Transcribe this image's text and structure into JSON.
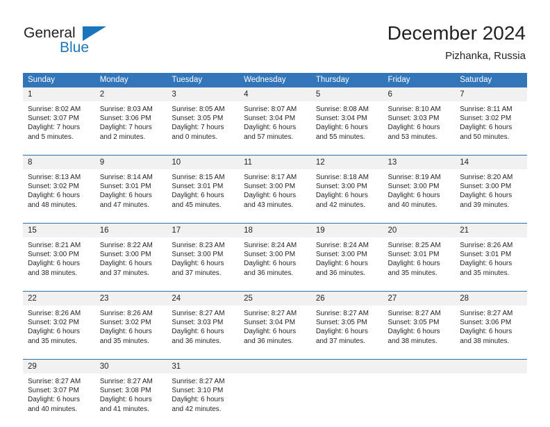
{
  "brand": {
    "name_part1": "General",
    "name_part2": "Blue"
  },
  "header": {
    "title": "December 2024",
    "subtitle": "Pizhanka, Russia"
  },
  "colors": {
    "header_blue": "#3275b9",
    "separator_blue": "#2f6fa8",
    "daynum_strip": "#f1f1f1",
    "brand_blue": "#1b75bb",
    "text": "#231f20"
  },
  "weekdays": [
    "Sunday",
    "Monday",
    "Tuesday",
    "Wednesday",
    "Thursday",
    "Friday",
    "Saturday"
  ],
  "weeks": [
    {
      "days": [
        {
          "num": "1",
          "sunrise": "Sunrise: 8:02 AM",
          "sunset": "Sunset: 3:07 PM",
          "daylight1": "Daylight: 7 hours",
          "daylight2": "and 5 minutes."
        },
        {
          "num": "2",
          "sunrise": "Sunrise: 8:03 AM",
          "sunset": "Sunset: 3:06 PM",
          "daylight1": "Daylight: 7 hours",
          "daylight2": "and 2 minutes."
        },
        {
          "num": "3",
          "sunrise": "Sunrise: 8:05 AM",
          "sunset": "Sunset: 3:05 PM",
          "daylight1": "Daylight: 7 hours",
          "daylight2": "and 0 minutes."
        },
        {
          "num": "4",
          "sunrise": "Sunrise: 8:07 AM",
          "sunset": "Sunset: 3:04 PM",
          "daylight1": "Daylight: 6 hours",
          "daylight2": "and 57 minutes."
        },
        {
          "num": "5",
          "sunrise": "Sunrise: 8:08 AM",
          "sunset": "Sunset: 3:04 PM",
          "daylight1": "Daylight: 6 hours",
          "daylight2": "and 55 minutes."
        },
        {
          "num": "6",
          "sunrise": "Sunrise: 8:10 AM",
          "sunset": "Sunset: 3:03 PM",
          "daylight1": "Daylight: 6 hours",
          "daylight2": "and 53 minutes."
        },
        {
          "num": "7",
          "sunrise": "Sunrise: 8:11 AM",
          "sunset": "Sunset: 3:02 PM",
          "daylight1": "Daylight: 6 hours",
          "daylight2": "and 50 minutes."
        }
      ]
    },
    {
      "days": [
        {
          "num": "8",
          "sunrise": "Sunrise: 8:13 AM",
          "sunset": "Sunset: 3:02 PM",
          "daylight1": "Daylight: 6 hours",
          "daylight2": "and 48 minutes."
        },
        {
          "num": "9",
          "sunrise": "Sunrise: 8:14 AM",
          "sunset": "Sunset: 3:01 PM",
          "daylight1": "Daylight: 6 hours",
          "daylight2": "and 47 minutes."
        },
        {
          "num": "10",
          "sunrise": "Sunrise: 8:15 AM",
          "sunset": "Sunset: 3:01 PM",
          "daylight1": "Daylight: 6 hours",
          "daylight2": "and 45 minutes."
        },
        {
          "num": "11",
          "sunrise": "Sunrise: 8:17 AM",
          "sunset": "Sunset: 3:00 PM",
          "daylight1": "Daylight: 6 hours",
          "daylight2": "and 43 minutes."
        },
        {
          "num": "12",
          "sunrise": "Sunrise: 8:18 AM",
          "sunset": "Sunset: 3:00 PM",
          "daylight1": "Daylight: 6 hours",
          "daylight2": "and 42 minutes."
        },
        {
          "num": "13",
          "sunrise": "Sunrise: 8:19 AM",
          "sunset": "Sunset: 3:00 PM",
          "daylight1": "Daylight: 6 hours",
          "daylight2": "and 40 minutes."
        },
        {
          "num": "14",
          "sunrise": "Sunrise: 8:20 AM",
          "sunset": "Sunset: 3:00 PM",
          "daylight1": "Daylight: 6 hours",
          "daylight2": "and 39 minutes."
        }
      ]
    },
    {
      "days": [
        {
          "num": "15",
          "sunrise": "Sunrise: 8:21 AM",
          "sunset": "Sunset: 3:00 PM",
          "daylight1": "Daylight: 6 hours",
          "daylight2": "and 38 minutes."
        },
        {
          "num": "16",
          "sunrise": "Sunrise: 8:22 AM",
          "sunset": "Sunset: 3:00 PM",
          "daylight1": "Daylight: 6 hours",
          "daylight2": "and 37 minutes."
        },
        {
          "num": "17",
          "sunrise": "Sunrise: 8:23 AM",
          "sunset": "Sunset: 3:00 PM",
          "daylight1": "Daylight: 6 hours",
          "daylight2": "and 37 minutes."
        },
        {
          "num": "18",
          "sunrise": "Sunrise: 8:24 AM",
          "sunset": "Sunset: 3:00 PM",
          "daylight1": "Daylight: 6 hours",
          "daylight2": "and 36 minutes."
        },
        {
          "num": "19",
          "sunrise": "Sunrise: 8:24 AM",
          "sunset": "Sunset: 3:00 PM",
          "daylight1": "Daylight: 6 hours",
          "daylight2": "and 36 minutes."
        },
        {
          "num": "20",
          "sunrise": "Sunrise: 8:25 AM",
          "sunset": "Sunset: 3:01 PM",
          "daylight1": "Daylight: 6 hours",
          "daylight2": "and 35 minutes."
        },
        {
          "num": "21",
          "sunrise": "Sunrise: 8:26 AM",
          "sunset": "Sunset: 3:01 PM",
          "daylight1": "Daylight: 6 hours",
          "daylight2": "and 35 minutes."
        }
      ]
    },
    {
      "days": [
        {
          "num": "22",
          "sunrise": "Sunrise: 8:26 AM",
          "sunset": "Sunset: 3:02 PM",
          "daylight1": "Daylight: 6 hours",
          "daylight2": "and 35 minutes."
        },
        {
          "num": "23",
          "sunrise": "Sunrise: 8:26 AM",
          "sunset": "Sunset: 3:02 PM",
          "daylight1": "Daylight: 6 hours",
          "daylight2": "and 35 minutes."
        },
        {
          "num": "24",
          "sunrise": "Sunrise: 8:27 AM",
          "sunset": "Sunset: 3:03 PM",
          "daylight1": "Daylight: 6 hours",
          "daylight2": "and 36 minutes."
        },
        {
          "num": "25",
          "sunrise": "Sunrise: 8:27 AM",
          "sunset": "Sunset: 3:04 PM",
          "daylight1": "Daylight: 6 hours",
          "daylight2": "and 36 minutes."
        },
        {
          "num": "26",
          "sunrise": "Sunrise: 8:27 AM",
          "sunset": "Sunset: 3:05 PM",
          "daylight1": "Daylight: 6 hours",
          "daylight2": "and 37 minutes."
        },
        {
          "num": "27",
          "sunrise": "Sunrise: 8:27 AM",
          "sunset": "Sunset: 3:05 PM",
          "daylight1": "Daylight: 6 hours",
          "daylight2": "and 38 minutes."
        },
        {
          "num": "28",
          "sunrise": "Sunrise: 8:27 AM",
          "sunset": "Sunset: 3:06 PM",
          "daylight1": "Daylight: 6 hours",
          "daylight2": "and 38 minutes."
        }
      ]
    },
    {
      "days": [
        {
          "num": "29",
          "sunrise": "Sunrise: 8:27 AM",
          "sunset": "Sunset: 3:07 PM",
          "daylight1": "Daylight: 6 hours",
          "daylight2": "and 40 minutes."
        },
        {
          "num": "30",
          "sunrise": "Sunrise: 8:27 AM",
          "sunset": "Sunset: 3:08 PM",
          "daylight1": "Daylight: 6 hours",
          "daylight2": "and 41 minutes."
        },
        {
          "num": "31",
          "sunrise": "Sunrise: 8:27 AM",
          "sunset": "Sunset: 3:10 PM",
          "daylight1": "Daylight: 6 hours",
          "daylight2": "and 42 minutes."
        },
        {
          "num": "",
          "sunrise": "",
          "sunset": "",
          "daylight1": "",
          "daylight2": ""
        },
        {
          "num": "",
          "sunrise": "",
          "sunset": "",
          "daylight1": "",
          "daylight2": ""
        },
        {
          "num": "",
          "sunrise": "",
          "sunset": "",
          "daylight1": "",
          "daylight2": ""
        },
        {
          "num": "",
          "sunrise": "",
          "sunset": "",
          "daylight1": "",
          "daylight2": ""
        }
      ]
    }
  ]
}
